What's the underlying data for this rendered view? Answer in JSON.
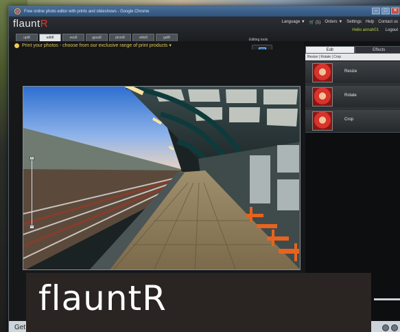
{
  "browser": {
    "title": "Free online photo editor with prints and slideshows - Google Chrome",
    "controls": [
      "–",
      "□",
      "✕"
    ]
  },
  "app": {
    "logo_main": "flaunt",
    "logo_accent": "R",
    "nav": [
      "Language ▼",
      "🛒 (1)",
      "Orders ▼",
      "Settings",
      "Help",
      "Contact us"
    ],
    "greeting": "Hello annah01",
    "logout": "Logout",
    "tabs": [
      "upl8",
      "edit8",
      "eos8",
      "gpus8",
      "ptcm8",
      "stdc8",
      "gaf8"
    ],
    "active_tab": 1
  },
  "promo": {
    "text": "Print your photos - choose from our exclusive range of print products ▾"
  },
  "editing_tools": {
    "label": "Editing tools",
    "get_photo": "Get Photo"
  },
  "zoom": {
    "plus": "+",
    "minus": "–"
  },
  "side_panel": {
    "tabs": [
      "Edit",
      "Effects"
    ],
    "active_tab": 0,
    "breadcrumb": "Resize | Rotate | Crop",
    "tools": [
      {
        "label": "Resize"
      },
      {
        "label": "Rotate"
      },
      {
        "label": "Crop"
      }
    ]
  },
  "statusbar": {
    "text": "Get"
  },
  "caption": {
    "text": "flauntR"
  },
  "colors": {
    "accent": "#e53b2c",
    "promo": "#e0c85a"
  }
}
